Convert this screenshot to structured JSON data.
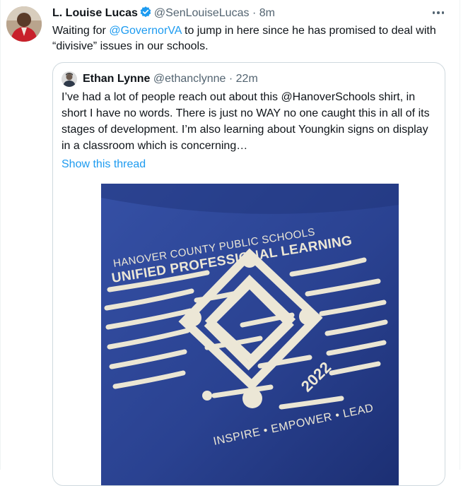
{
  "tweet": {
    "author_name": "L. Louise Lucas",
    "handle": "@SenLouiseLucas",
    "separator": "·",
    "time": "8m",
    "text_before": "Waiting for ",
    "mention": "@GovernorVA",
    "text_after": " to jump in here since he has promised to deal with “divisive” issues in our schools."
  },
  "quote": {
    "author_name": "Ethan Lynne",
    "handle": "@ethanclynne",
    "separator": "·",
    "time": "22m",
    "text": "I’ve had a lot of people reach out about this @HanoverSchools shirt, in short I have no words. There is just no WAY no one caught this in all of its stages of development. I’m also learning about Youngkin signs on display in a classroom which is concerning…",
    "show_thread": "Show this thread"
  },
  "shirt": {
    "line1": "HANOVER COUNTY PUBLIC SCHOOLS",
    "line2": "UNIFIED PROFESSIONAL LEARNING",
    "year": "2022",
    "tagline": "INSPIRE • EMPOWER • LEAD"
  },
  "icons": {
    "verified": "verified-badge-icon",
    "more": "more-options-icon"
  },
  "colors": {
    "accent": "#1d9bf0",
    "text": "#0f1419",
    "muted": "#536471",
    "border": "#cfd9de",
    "shirt": "#2a4291"
  }
}
